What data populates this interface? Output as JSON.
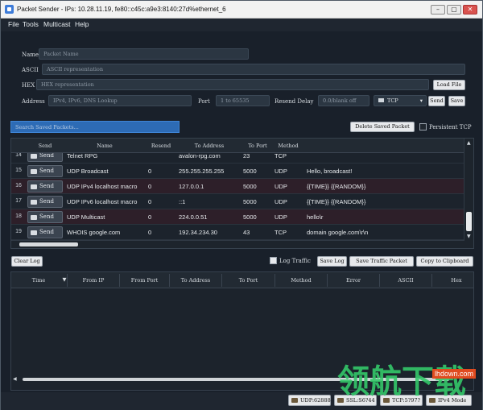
{
  "window": {
    "title": "Packet Sender - IPs: 10.28.11.19, fe80::c45c:a9e3:8140:27d%ethernet_6",
    "controls": [
      "–",
      "▢",
      "✕"
    ]
  },
  "menu": [
    "File",
    "Tools",
    "Multicast",
    "Help"
  ],
  "form": {
    "name_label": "Name",
    "name_placeholder": "Packet Name",
    "ascii_label": "ASCII",
    "ascii_placeholder": "ASCII representation",
    "hex_label": "HEX",
    "hex_placeholder": "HEX representation",
    "load_file": "Load File",
    "address_label": "Address",
    "address_placeholder": "IPv4, IPv6, DNS Lookup",
    "port_label": "Port",
    "port_placeholder": "1 to 65535",
    "resend_label": "Resend Delay",
    "resend_placeholder": "0.0/blank off",
    "protocol": "TCP",
    "send": "Send",
    "save": "Save"
  },
  "saved": {
    "search_placeholder": "Search Saved Packets...",
    "delete_button": "Delete Saved Packet",
    "persistent_label": "Persistent TCP",
    "columns": [
      "Send",
      "Name",
      "Resend",
      "To Address",
      "To Port",
      "Method"
    ],
    "rows": [
      {
        "num": "14",
        "send": "Send",
        "name": "Telnet RPG",
        "resend": "",
        "address": "avalon-rpg.com",
        "port": "23",
        "method": "TCP",
        "ascii": ""
      },
      {
        "num": "15",
        "send": "Send",
        "name": "UDP Broadcast",
        "resend": "0",
        "address": "255.255.255.255",
        "port": "5000",
        "method": "UDP",
        "ascii": "Hello, broadcast!"
      },
      {
        "num": "16",
        "send": "Send",
        "name": "UDP IPv4 localhost macro",
        "resend": "0",
        "address": "127.0.0.1",
        "port": "5000",
        "method": "UDP",
        "ascii": "{{TIME}} {{RANDOM}}"
      },
      {
        "num": "17",
        "send": "Send",
        "name": "UDP IPv6 localhost macro",
        "resend": "0",
        "address": "::1",
        "port": "5000",
        "method": "UDP",
        "ascii": "{{TIME}} {{RANDOM}}"
      },
      {
        "num": "18",
        "send": "Send",
        "name": "UDP Multicast",
        "resend": "0",
        "address": "224.0.0.51",
        "port": "5000",
        "method": "UDP",
        "ascii": "hello\\r"
      },
      {
        "num": "19",
        "send": "Send",
        "name": "WHOIS google.com",
        "resend": "0",
        "address": "192.34.234.30",
        "port": "43",
        "method": "TCP",
        "ascii": "domain google.com\\r\\n"
      }
    ]
  },
  "traffic": {
    "clear_log": "Clear Log",
    "log_traffic": "Log Traffic",
    "save_log": "Save Log",
    "save_traffic_packet": "Save Traffic Packet",
    "copy_clipboard": "Copy to Clipboard",
    "columns": [
      "Time",
      "From IP",
      "From Port",
      "To Address",
      "To Port",
      "Method",
      "Error",
      "ASCII",
      "Hex"
    ],
    "sort_indicator": "▼"
  },
  "statusbar": {
    "udp": "UDP:62888",
    "ssl": "SSL:S6?44",
    "tcp": "TCP:5?97?",
    "ipv4": "IPv4 Mode"
  },
  "watermark": {
    "chinese": "领航下载",
    "site": "lhdown.com"
  }
}
